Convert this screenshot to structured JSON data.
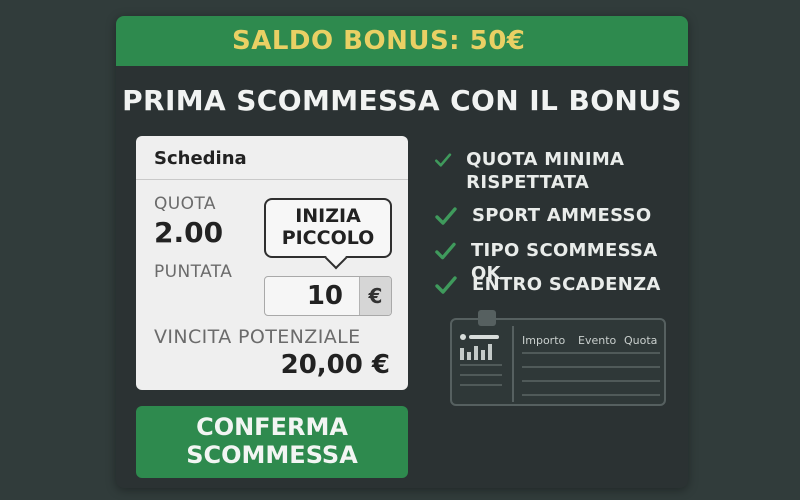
{
  "banner": {
    "bonus_text": "SALDO BONUS: 50€"
  },
  "title": "PRIMA SCOMMESSA CON IL BONUS",
  "slip": {
    "header": "Schedina",
    "quota_label": "QUOTA",
    "quota_value": "2.00",
    "puntata_label": "PUNTATA",
    "stake_value": "10",
    "currency_symbol": "€",
    "vincita_label": "VINCITA POTENZIALE",
    "vincita_value": "20,00 €"
  },
  "tip": {
    "line1": "INIZIA",
    "line2": "PICCOLO"
  },
  "confirm_button": {
    "line1": "CONFERMA",
    "line2": "SCOMMESSA"
  },
  "checklist": [
    {
      "label": "QUOTA MINIMA RISPETTATA",
      "icon": "check-icon"
    },
    {
      "label": "SPORT AMMESSO",
      "icon": "check-icon"
    },
    {
      "label": "TIPO SCOMMESSA OK",
      "icon": "check-icon"
    },
    {
      "label": "ENTRO SCADENZA",
      "icon": "check-icon"
    }
  ],
  "ticket": {
    "columns": [
      "Importo",
      "Evento",
      "Quota"
    ]
  },
  "colors": {
    "background": "#313c3b",
    "panel": "#2b3233",
    "accent_green": "#2e8a4e",
    "bonus_yellow": "#e9d064",
    "check_green": "#3f9a5c"
  }
}
